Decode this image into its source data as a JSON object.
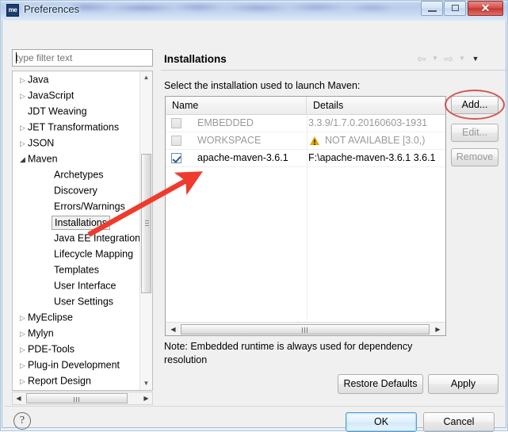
{
  "window": {
    "title": "Preferences",
    "app_icon_label": "me",
    "controls": {
      "minimize": "minimize-button",
      "maximize": "maximize-button",
      "close_glyph": "✕"
    }
  },
  "filter": {
    "value": "",
    "placeholder": "type filter text"
  },
  "tree": {
    "items": [
      {
        "label": "Java",
        "depth": 1,
        "twisty": "collapsed",
        "selected": false
      },
      {
        "label": "JavaScript",
        "depth": 1,
        "twisty": "collapsed",
        "selected": false
      },
      {
        "label": "JDT Weaving",
        "depth": 1,
        "twisty": "none",
        "selected": false
      },
      {
        "label": "JET Transformations",
        "depth": 1,
        "twisty": "collapsed",
        "selected": false
      },
      {
        "label": "JSON",
        "depth": 1,
        "twisty": "collapsed",
        "selected": false
      },
      {
        "label": "Maven",
        "depth": 1,
        "twisty": "expanded",
        "selected": false
      },
      {
        "label": "Archetypes",
        "depth": 2,
        "twisty": "none",
        "selected": false
      },
      {
        "label": "Discovery",
        "depth": 2,
        "twisty": "none",
        "selected": false
      },
      {
        "label": "Errors/Warnings",
        "depth": 2,
        "twisty": "none",
        "selected": false
      },
      {
        "label": "Installations",
        "depth": 2,
        "twisty": "none",
        "selected": true
      },
      {
        "label": "Java EE Integration",
        "depth": 2,
        "twisty": "none",
        "selected": false
      },
      {
        "label": "Lifecycle Mapping",
        "depth": 2,
        "twisty": "none",
        "selected": false
      },
      {
        "label": "Templates",
        "depth": 2,
        "twisty": "none",
        "selected": false
      },
      {
        "label": "User Interface",
        "depth": 2,
        "twisty": "none",
        "selected": false
      },
      {
        "label": "User Settings",
        "depth": 2,
        "twisty": "none",
        "selected": false
      },
      {
        "label": "MyEclipse",
        "depth": 1,
        "twisty": "collapsed",
        "selected": false
      },
      {
        "label": "Mylyn",
        "depth": 1,
        "twisty": "collapsed",
        "selected": false
      },
      {
        "label": "PDE-Tools",
        "depth": 1,
        "twisty": "collapsed",
        "selected": false
      },
      {
        "label": "Plug-in Development",
        "depth": 1,
        "twisty": "collapsed",
        "selected": false
      },
      {
        "label": "Report Design",
        "depth": 1,
        "twisty": "collapsed",
        "selected": false
      }
    ],
    "twisty_collapsed_glyph": "▷",
    "twisty_expanded_glyph": "◢"
  },
  "page": {
    "title": "Installations",
    "instruction": "Select the installation used to launch Maven:",
    "note": "Note: Embedded runtime is always used for dependency resolution"
  },
  "nav": {
    "back_glyph": "⇦",
    "forward_glyph": "⇨",
    "caret_glyph": "▼",
    "menu_glyph": "▼"
  },
  "table": {
    "columns": [
      "Name",
      "Details"
    ],
    "rows": [
      {
        "checked": false,
        "enabled": false,
        "name": "EMBEDDED",
        "details": "3.3.9/1.7.0.20160603-1931",
        "warning": false
      },
      {
        "checked": false,
        "enabled": false,
        "name": "WORKSPACE",
        "details": "NOT AVAILABLE [3.0,)",
        "warning": true
      },
      {
        "checked": true,
        "enabled": true,
        "name": "apache-maven-3.6.1",
        "details": "F:\\apache-maven-3.6.1 3.6.1",
        "warning": false
      }
    ]
  },
  "side_buttons": [
    {
      "label": "Add...",
      "enabled": true,
      "highlighted": true
    },
    {
      "label": "Edit...",
      "enabled": false,
      "highlighted": false
    },
    {
      "label": "Remove",
      "enabled": false,
      "highlighted": false
    }
  ],
  "page_buttons": {
    "restore_defaults": "Restore Defaults",
    "apply": "Apply"
  },
  "dialog_buttons": {
    "ok": "OK",
    "cancel": "Cancel",
    "help_glyph": "?"
  },
  "scroll": {
    "arrow_up": "▲",
    "arrow_down": "▼",
    "arrow_left": "◀",
    "arrow_right": "▶"
  },
  "colors": {
    "accent_blue": "#4b9fd4",
    "annotation_red": "#ef3b2d",
    "ellipse_red": "#cf3a3a",
    "warning_amber": "#e0a800",
    "disabled_gray": "#999999",
    "close_button_red": "#c03a33"
  }
}
